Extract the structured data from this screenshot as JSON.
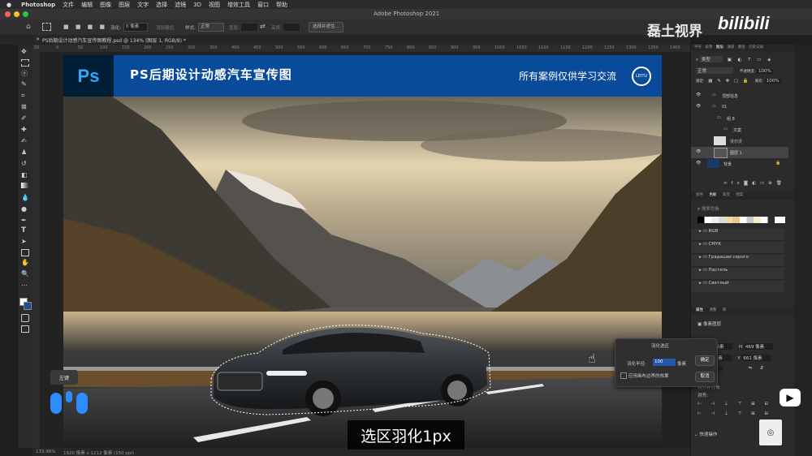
{
  "menubar": {
    "items": [
      "Photoshop",
      "文件",
      "编辑",
      "图像",
      "图层",
      "文字",
      "选择",
      "滤镜",
      "3D",
      "视图",
      "增效工具",
      "窗口",
      "帮助"
    ]
  },
  "titlebar": {
    "title": "Adobe Photoshop 2021"
  },
  "optionsbar": {
    "feather_label": "羽化:",
    "feather_value": "0 像素",
    "antialias_label": "消除锯齿",
    "style_label": "样式:",
    "style_value": "正常",
    "width_label": "宽度:",
    "height_label": "高度:",
    "select_mask_button": "选择并遮住..."
  },
  "doc_tab": {
    "label": "PS后期设计动感汽车宣传图教程.psd @ 134% (图层 1, RGB/8) *"
  },
  "ruler": {
    "ticks": [
      "50",
      "0",
      "50",
      "100",
      "150",
      "200",
      "250",
      "300",
      "350",
      "400",
      "450",
      "500",
      "550",
      "600",
      "650",
      "700",
      "750",
      "800",
      "850",
      "900",
      "950",
      "1000",
      "1050",
      "1100",
      "1150",
      "1200",
      "1250",
      "1300",
      "1350",
      "1400"
    ]
  },
  "banner": {
    "logo": "Ps",
    "title": "PS后期设计动感汽车宣传图",
    "right_text": "所有案例仅供学习交流",
    "badge": "LEITU"
  },
  "statusbar": {
    "zoom": "133.96%",
    "info": "1920 像素 x 1212 像素 (150 ppi)"
  },
  "watermark": {
    "cn": "磊土视界",
    "bili": "bilibili"
  },
  "layers_panel": {
    "tabs": [
      "字符",
      "段落",
      "图层",
      "通道",
      "路径",
      "历史记录"
    ],
    "kind_label": "类型",
    "blend_mode": "正常",
    "opacity_label": "不透明度:",
    "opacity_value": "100%",
    "lock_label": "锁定:",
    "fill_label": "填充:",
    "fill_value": "100%",
    "layers": [
      {
        "name": "顶部信息"
      },
      {
        "name": "01"
      },
      {
        "name": "组 8"
      },
      {
        "name": "文案"
      },
      {
        "name": "沃尔沃"
      },
      {
        "name": "图层 1"
      },
      {
        "name": "背景"
      }
    ]
  },
  "swatches_panel": {
    "tabs": [
      "颜色",
      "色板",
      "渐变",
      "图案"
    ],
    "search_placeholder": "搜索色板",
    "groups": [
      "RGB",
      "CMYK",
      "Градации серого",
      "Пастель",
      "Светлый"
    ]
  },
  "properties_panel": {
    "tabs": [
      "属性",
      "调整",
      "库"
    ],
    "type_label": "像素图层",
    "w_label": "W",
    "w_value": "894 像素",
    "h_label": "H",
    "h_value": "469 像素",
    "x_label": "X",
    "x_value": "380 像素",
    "y_label": "Y",
    "y_value": "661 像素",
    "angle_value": "0.00°",
    "align_label": "对齐并分布",
    "align_sub": "对齐:",
    "quick_actions": "快速操作"
  },
  "feather_dialog": {
    "title": "羽化选区",
    "radius_label": "羽化半径:",
    "radius_value": "100",
    "unit": "像素",
    "checkbox_label": "应用画布边界的效果",
    "ok": "确定",
    "cancel": "取消"
  },
  "overlay": {
    "key_hint": "左键",
    "subtitle": "选区羽化1px"
  },
  "colors": {
    "banner_blue": "#0a4a9a",
    "ps_blue": "#31a8ff",
    "ps_navy": "#001e36",
    "ui_dark": "#2b2b2b"
  }
}
